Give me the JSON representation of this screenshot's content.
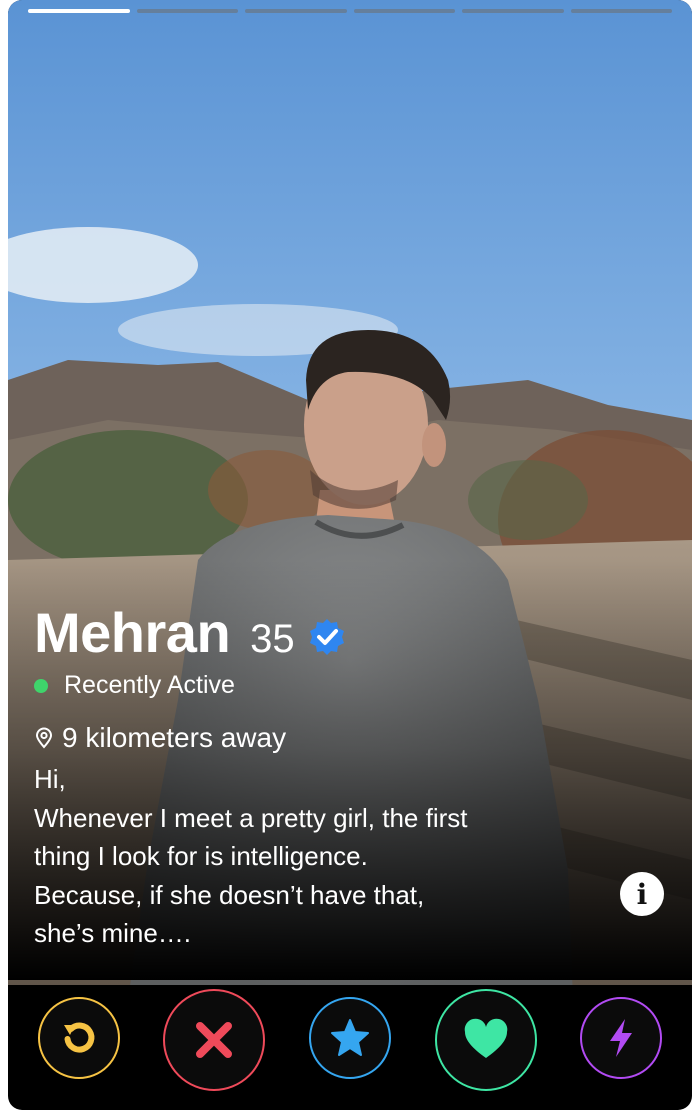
{
  "progress": {
    "total": 6,
    "active_index": 0
  },
  "profile": {
    "name": "Mehran",
    "age": "35",
    "verified": true,
    "status": "Recently Active",
    "distance": "9 kilometers away",
    "bio": "Hi,\nWhenever I meet a pretty girl, the first\nthing I look for is intelligence.\nBecause, if she doesn’t have that,\nshe’s mine…."
  },
  "icons": {
    "verified": "verified-check-icon",
    "location": "location-pin-icon",
    "info": "info-icon"
  },
  "info_button": {
    "glyph": "i"
  },
  "actions": [
    {
      "name": "rewind-button",
      "icon": "rewind-icon",
      "color": "#f6c344"
    },
    {
      "name": "nope-button",
      "icon": "close-icon",
      "color": "#ef4a5a"
    },
    {
      "name": "super-like-button",
      "icon": "star-icon",
      "color": "#35a6f0"
    },
    {
      "name": "like-button",
      "icon": "heart-icon",
      "color": "#3ee6a4"
    },
    {
      "name": "boost-button",
      "icon": "lightning-icon",
      "color": "#b24bf3"
    }
  ],
  "colors": {
    "active_dot": "#3fd46b",
    "verified_badge": "#2f86f0"
  }
}
